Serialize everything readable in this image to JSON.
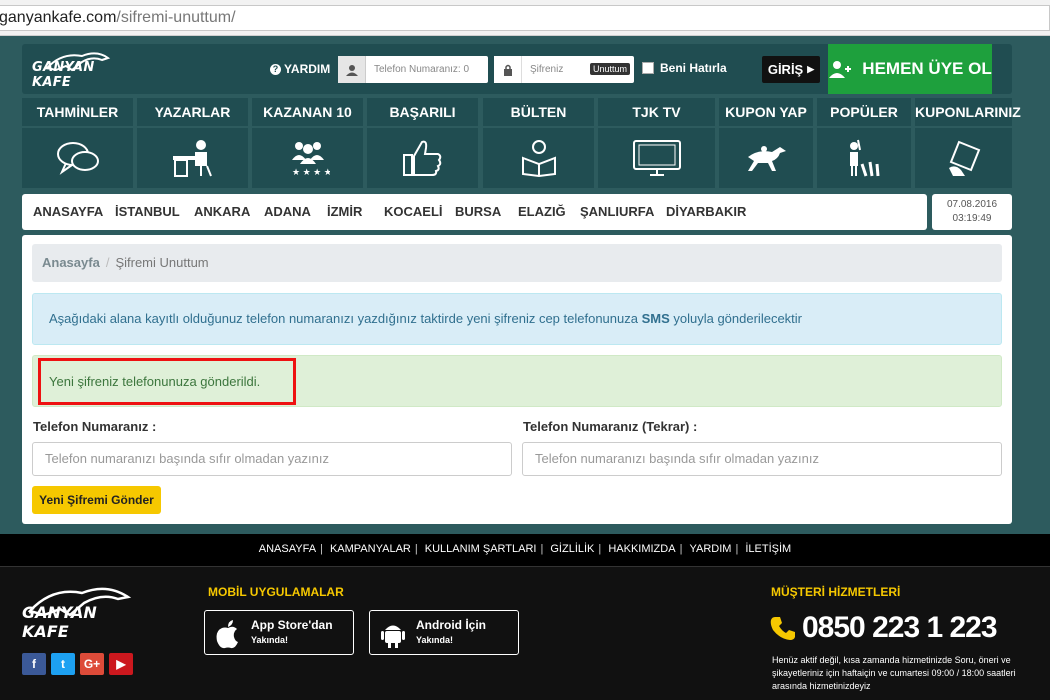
{
  "browser": {
    "url_host": "ganyankafe.com",
    "url_path": "/sifremi-unuttum/"
  },
  "header": {
    "logo_text": "GANYAN KAFE",
    "help_label": "YARDIM",
    "phone_placeholder": "Telefon Numaranız: 0",
    "password_placeholder": "Şifreniz",
    "forgot_label": "Unuttum",
    "remember_label": "Beni Hatırla",
    "login_label": "GİRİŞ",
    "signup_label": "HEMEN ÜYE OL"
  },
  "menu": [
    {
      "label": "TAHMİNLER",
      "icon": "chat-bubbles-icon"
    },
    {
      "label": "YAZARLAR",
      "icon": "writer-desk-icon"
    },
    {
      "label": "KAZANAN 10",
      "icon": "people-stars-icon"
    },
    {
      "label": "BAŞARILI",
      "icon": "thumbs-up-icon"
    },
    {
      "label": "BÜLTEN",
      "icon": "reader-icon"
    },
    {
      "label": "TJK TV",
      "icon": "tv-icon"
    },
    {
      "label": "KUPON YAP",
      "icon": "racehorse-icon"
    },
    {
      "label": "POPÜLER",
      "icon": "crowd-icon"
    },
    {
      "label": "KUPONLARINIZ",
      "icon": "ticket-hand-icon"
    }
  ],
  "cities": [
    "ANASAYFA",
    "İSTANBUL",
    "ANKARA",
    "ADANA",
    "İZMİR",
    "KOCAELİ",
    "BURSA",
    "ELAZIĞ",
    "ŞANLIURFA",
    "DİYARBAKIR"
  ],
  "datetime": {
    "date": "07.08.2016",
    "time": "03:19:49"
  },
  "breadcrumb": {
    "home": "Anasayfa",
    "current": "Şifremi Unuttum"
  },
  "alerts": {
    "info_text": "Aşağıdaki alana kayıtlı olduğunuz telefon numaranızı  yazdığınız taktirde yeni şifreniz cep telefonunuza ",
    "info_bold": "SMS",
    "info_tail": " yoluyla gönderilecektir",
    "success_text": "Yeni şifreniz telefonunuza gönderildi."
  },
  "form": {
    "phone_label": "Telefon Numaranız :",
    "phone_repeat_label": "Telefon Numaranız (Tekrar) :",
    "phone_placeholder": "Telefon numaranızı başında sıfır olmadan yazınız",
    "phone_repeat_placeholder": "Telefon numaranızı başında sıfır olmadan yazınız",
    "submit_label": "Yeni Şifremi Gönder"
  },
  "footer_links": [
    "ANASAYFA",
    "KAMPANYALAR",
    "KULLANIM ŞARTLARI",
    "GİZLİLİK",
    "HAKKIMIZDA",
    "YARDIM",
    "İLETİŞİM"
  ],
  "footer": {
    "logo_text": "GANYAN KAFE",
    "social": [
      "f",
      "t",
      "G+",
      "▶"
    ],
    "mobile_title": "MOBİL UYGULAMALAR",
    "appstore_title": "App Store'dan",
    "appstore_sub": "Yakında!",
    "android_title": "Android İçin",
    "android_sub": "Yakında!",
    "support_title": "MÜŞTERİ HİZMETLERİ",
    "phone": "0850 223 1 223",
    "note": "Henüz aktif değil, kısa zamanda hizmetinizde Soru, öneri ve şikayetleriniz için haftaiçin ve cumartesi 09:00 / 18:00 saatleri arasında hizmetinizdeyiz"
  },
  "colors": {
    "dark_teal": "#204d51",
    "bg_teal": "#2d5b5e",
    "signup_green": "#1ea03d",
    "button_yellow": "#f6c800"
  }
}
